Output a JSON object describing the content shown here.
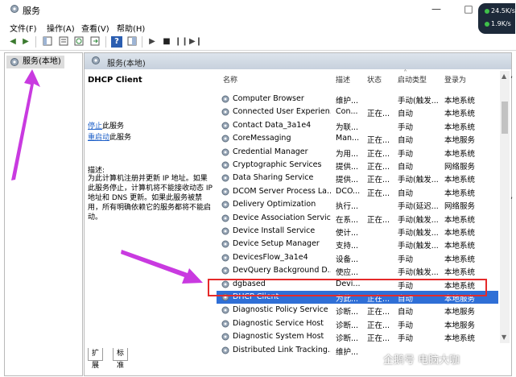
{
  "window": {
    "title": "服务"
  },
  "net_widget": {
    "up": "24.5",
    "up_unit": "K/s",
    "down": "1.9",
    "down_unit": "K/s"
  },
  "menu": [
    "文件(F)",
    "操作(A)",
    "查看(V)",
    "帮助(H)"
  ],
  "toolbar_icons": [
    "back-icon",
    "forward-icon",
    "console-tree-icon",
    "properties-icon",
    "refresh-icon",
    "export-icon",
    "help-icon",
    "show-pane-icon",
    "play-icon",
    "stop-icon",
    "pause-icon",
    "restart-icon"
  ],
  "tree": {
    "item": "服务(本地)"
  },
  "pane_header": "服务(本地)",
  "detail": {
    "service_title": "DHCP Client",
    "stop_link": "停止",
    "stop_suffix": "此服务",
    "restart_link": "重启动",
    "restart_suffix": "此服务",
    "desc_label": "描述:",
    "desc_text": "为此计算机注册并更新 IP 地址。如果此服务停止，计算机将不能接收动态 IP 地址和 DNS 更新。如果此服务被禁用，所有明确依赖它的服务都将不能启动。"
  },
  "columns": {
    "name": "名称",
    "desc": "描述",
    "status": "状态",
    "startup": "启动类型",
    "logon": "登录为"
  },
  "rows": [
    {
      "name": "Computer Browser",
      "desc": "维护...",
      "status": "",
      "startup": "手动(触发...",
      "logon": "本地系统"
    },
    {
      "name": "Connected User Experien...",
      "desc": "Con...",
      "status": "正在...",
      "startup": "自动",
      "logon": "本地系统"
    },
    {
      "name": "Contact Data_3a1e4",
      "desc": "为联...",
      "status": "",
      "startup": "手动",
      "logon": "本地系统"
    },
    {
      "name": "CoreMessaging",
      "desc": "Man...",
      "status": "正在...",
      "startup": "自动",
      "logon": "本地服务"
    },
    {
      "name": "Credential Manager",
      "desc": "为用...",
      "status": "正在...",
      "startup": "手动",
      "logon": "本地系统"
    },
    {
      "name": "Cryptographic Services",
      "desc": "提供...",
      "status": "正在...",
      "startup": "自动",
      "logon": "网络服务"
    },
    {
      "name": "Data Sharing Service",
      "desc": "提供...",
      "status": "正在...",
      "startup": "手动(触发...",
      "logon": "本地系统"
    },
    {
      "name": "DCOM Server Process La...",
      "desc": "DCO...",
      "status": "正在...",
      "startup": "自动",
      "logon": "本地系统"
    },
    {
      "name": "Delivery Optimization",
      "desc": "执行...",
      "status": "",
      "startup": "手动(延迟...",
      "logon": "网络服务"
    },
    {
      "name": "Device Association Service",
      "desc": "在系...",
      "status": "正在...",
      "startup": "手动(触发...",
      "logon": "本地系统"
    },
    {
      "name": "Device Install Service",
      "desc": "使计...",
      "status": "",
      "startup": "手动(触发...",
      "logon": "本地系统"
    },
    {
      "name": "Device Setup Manager",
      "desc": "支持...",
      "status": "",
      "startup": "手动(触发...",
      "logon": "本地系统"
    },
    {
      "name": "DevicesFlow_3a1e4",
      "desc": "设备...",
      "status": "",
      "startup": "手动",
      "logon": "本地系统"
    },
    {
      "name": "DevQuery Background D...",
      "desc": "使应...",
      "status": "",
      "startup": "手动(触发...",
      "logon": "本地系统"
    },
    {
      "name": "dgbased",
      "desc": "Devi...",
      "status": "",
      "startup": "手动",
      "logon": "本地系统"
    },
    {
      "name": "DHCP Client",
      "desc": "为此...",
      "status": "正在...",
      "startup": "自动",
      "logon": "本地服务",
      "selected": true
    },
    {
      "name": "Diagnostic Policy Service",
      "desc": "诊断...",
      "status": "正在...",
      "startup": "自动",
      "logon": "本地服务"
    },
    {
      "name": "Diagnostic Service Host",
      "desc": "诊断...",
      "status": "正在...",
      "startup": "手动",
      "logon": "本地服务"
    },
    {
      "name": "Diagnostic System Host",
      "desc": "诊断...",
      "status": "正在...",
      "startup": "手动",
      "logon": "本地系统"
    },
    {
      "name": "Distributed Link Tracking...",
      "desc": "维护...",
      "status": "",
      "startup": "",
      "logon": ""
    }
  ],
  "tabs": [
    "扩展",
    "标准"
  ],
  "watermark": "企鹅号 电脑大咖",
  "colors": {
    "selection": "#2f6fd6",
    "highlight_box": "#e52a2a",
    "arrow": "#c93ae0",
    "link": "#1d5fc8"
  }
}
